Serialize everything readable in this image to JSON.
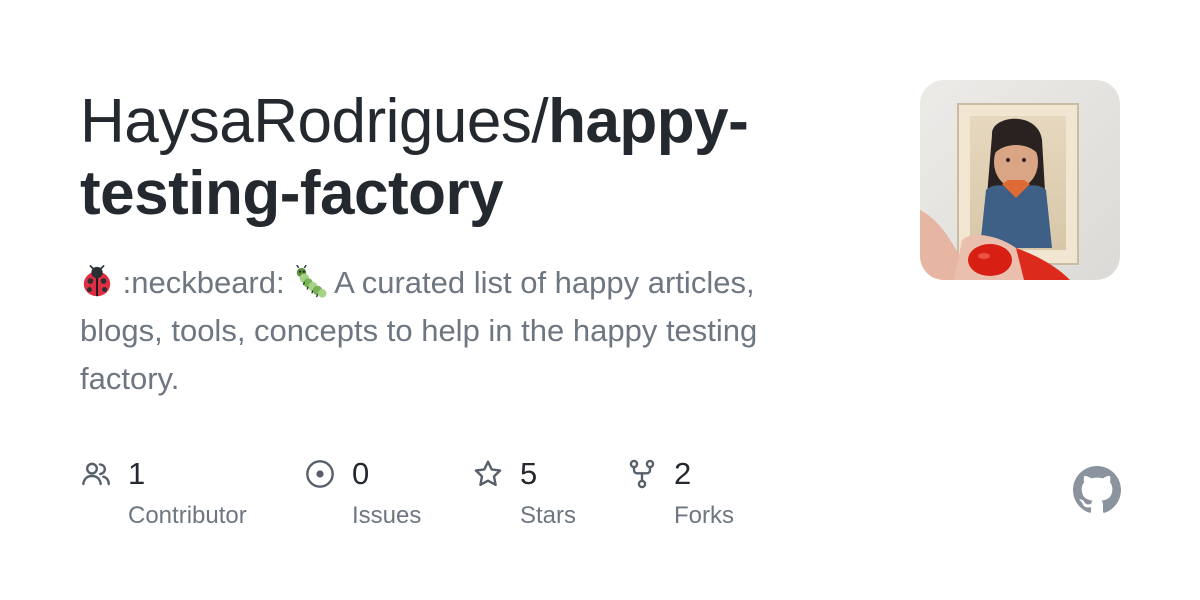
{
  "repo": {
    "owner": "HaysaRodrigues/",
    "name": "happy-testing-factory"
  },
  "description": {
    "emoji_1": "ladybug-emoji",
    "emoji_2": "caterpillar-emoji",
    "text_1": " :neckbeard: ",
    "text_2": " A curated list of happy articles, blogs, tools, concepts to help in the happy testing factory."
  },
  "avatar": {
    "icon": "repository-owner-avatar"
  },
  "stats": {
    "contributors": {
      "value": "1",
      "label": "Contributor",
      "icon": "people-icon"
    },
    "issues": {
      "value": "0",
      "label": "Issues",
      "icon": "issue-opened-icon"
    },
    "stars": {
      "value": "5",
      "label": "Stars",
      "icon": "star-icon"
    },
    "forks": {
      "value": "2",
      "label": "Forks",
      "icon": "repo-forked-icon"
    }
  },
  "logo": {
    "icon": "github-mark-icon"
  },
  "colors": {
    "title": "#24292f",
    "muted": "#6e7781",
    "icon": "#57606a",
    "logo": "#8b949e"
  }
}
